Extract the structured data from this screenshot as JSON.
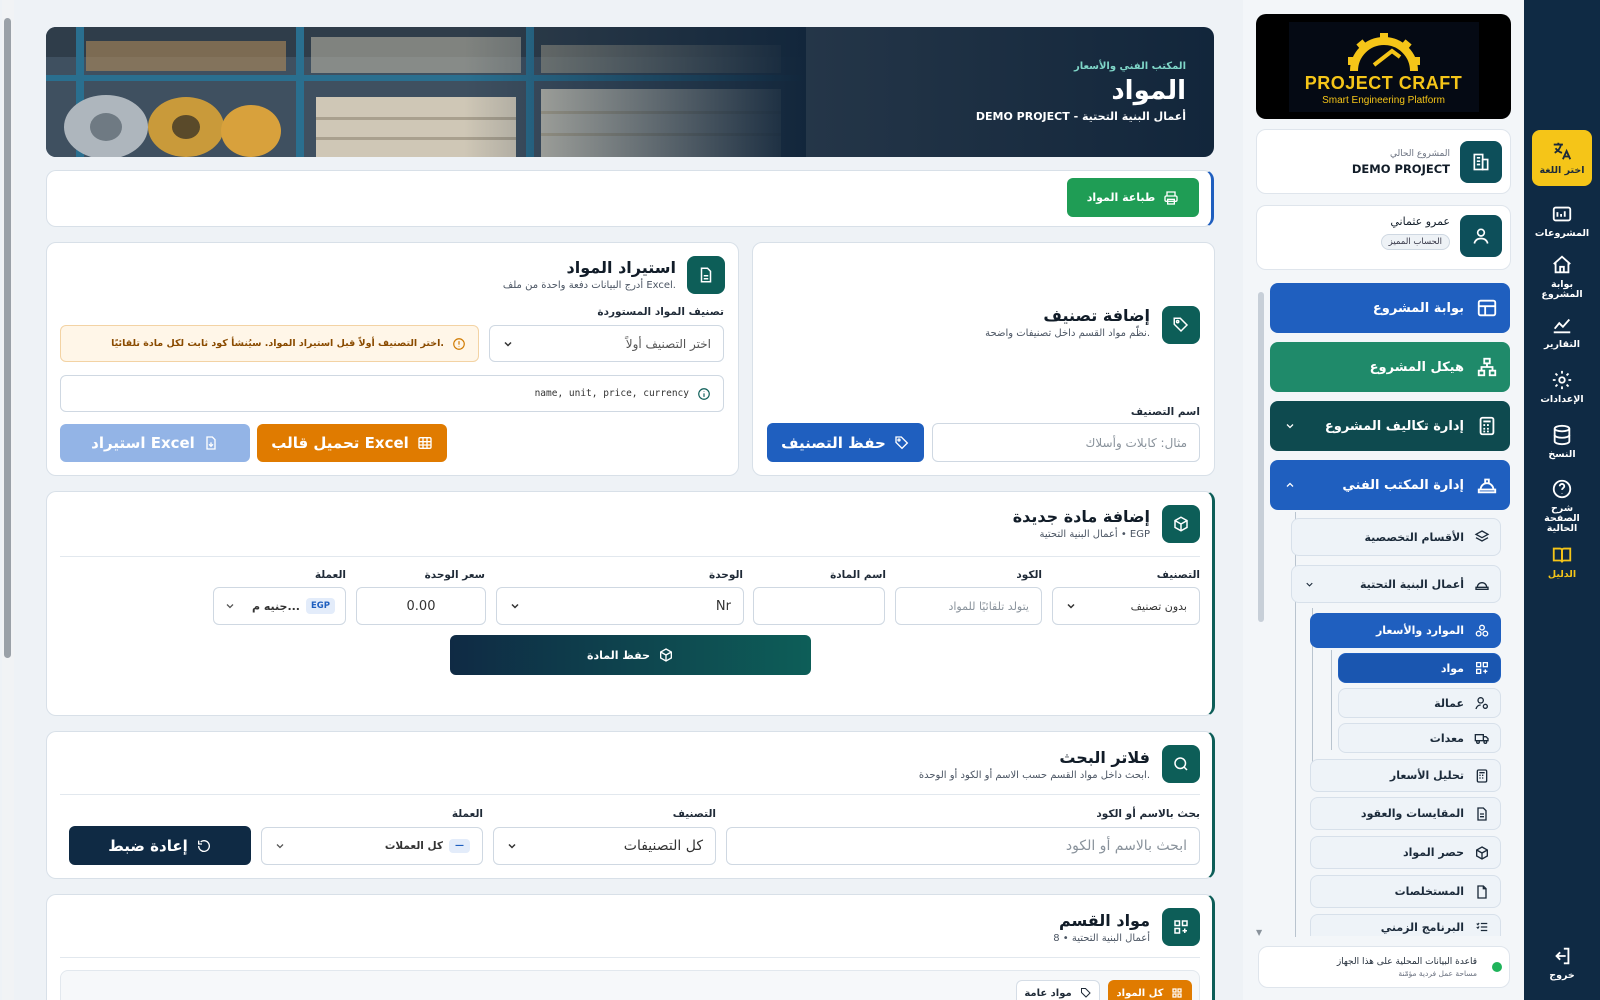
{
  "rail": {
    "language": "اختر اللغة",
    "projects": "المشروعات",
    "project_portal": "بوابة المشروع",
    "reports": "التقارير",
    "settings": "الإعدادات",
    "backup": "النسخ",
    "explain": "شرح الصفحة الحالية",
    "guide": "الدليل",
    "logout": "خروج"
  },
  "logo": {
    "title": "PROJECT CRAFT",
    "subtitle": "Smart Engineering Platform"
  },
  "current_project": {
    "label": "المشروع الحالي",
    "name": "DEMO PROJECT"
  },
  "user": {
    "name": "عمرو عثماني",
    "badge": "الحساب المميز"
  },
  "nav": {
    "project_portal": "بوابة المشروع",
    "project_structure": "هيكل المشروع",
    "cost_management": "إدارة تكاليف المشروع",
    "technical_office": "إدارة المكتب الفني",
    "divisions": "الأقسام التخصصية",
    "infrastructure": "أعمال البنية التحتية",
    "resources_prices": "الموارد والأسعار",
    "materials": "مواد",
    "labor": "عمالة",
    "equipment": "معدات",
    "price_analysis": "تحليل الأسعار",
    "quantities_contracts": "المقايسات والعقود",
    "material_takeoff": "حصر المواد",
    "invoices": "المستخلصات",
    "schedule": "البرنامج الزمني"
  },
  "local_db": {
    "title": "قاعدة البيانات المحلية على هذا الجهاز",
    "subtitle": "مساحة عمل فردية مؤمّنة"
  },
  "hero": {
    "kicker": "المكتب الفني والأسعار",
    "title": "المواد",
    "subtitle": "DEMO PROJECT - أعمال البنية التحتية"
  },
  "print_button": "طباعة المواد",
  "add_category": {
    "title": "إضافة تصنيف",
    "subtitle": "نظّم مواد القسم داخل تصنيفات واضحة.",
    "name_label": "اسم التصنيف",
    "name_placeholder": "مثال: كابلات وأسلاك",
    "save_button": "حفظ التصنيف"
  },
  "import": {
    "title": "استيراد المواد",
    "subtitle": "أدرج البيانات دفعة واحدة من ملف Excel.",
    "category_label": "تصنيف المواد المستوردة",
    "category_placeholder": "اختر التصنيف أولاً",
    "warning": "اختر التصنيف أولاً قبل استيراد المواد. سيُنشأ كود ثابت لكل مادة تلقائيًا.",
    "columns_hint": "name, unit, price, currency",
    "download_template": "تحميل قالب Excel",
    "import_button": "استيراد Excel"
  },
  "add_material": {
    "title": "إضافة مادة جديدة",
    "subtitle": "أعمال البنية التحتية • EGP",
    "category_label": "التصنيف",
    "category_value": "بدون تصنيف",
    "code_label": "الكود",
    "code_placeholder": "يتولد تلقائيًا للمواد",
    "name_label": "اسم المادة",
    "unit_label": "الوحدة",
    "unit_value": "Nr",
    "price_label": "سعر الوحدة",
    "price_value": "0.00",
    "currency_label": "العملة",
    "currency_code": "EGP",
    "currency_value": "جنيه م...",
    "save_button": "حفظ المادة"
  },
  "filters": {
    "title": "فلاتر البحث",
    "subtitle": "ابحث داخل مواد القسم حسب الاسم أو الكود أو الوحدة.",
    "search_label": "بحث بالاسم أو الكود",
    "search_placeholder": "ابحث بالاسم أو الكود",
    "category_label": "التصنيف",
    "category_value": "كل التصنيفات",
    "currency_label": "العملة",
    "currency_badge": "—",
    "currency_value": "كل العملات",
    "reset_button": "إعادة ضبط"
  },
  "section_materials": {
    "title": "مواد القسم",
    "subtitle": "8 • أعمال البنية التحتية",
    "tab_all": "كل المواد",
    "tab_general": "مواد عامة"
  },
  "colors": {
    "navy": "#0f2a44",
    "blue": "#1f5fbf",
    "teal": "#0d5e58",
    "green": "#1f9d55",
    "orange": "#e07b00",
    "yellow": "#f5c518"
  }
}
